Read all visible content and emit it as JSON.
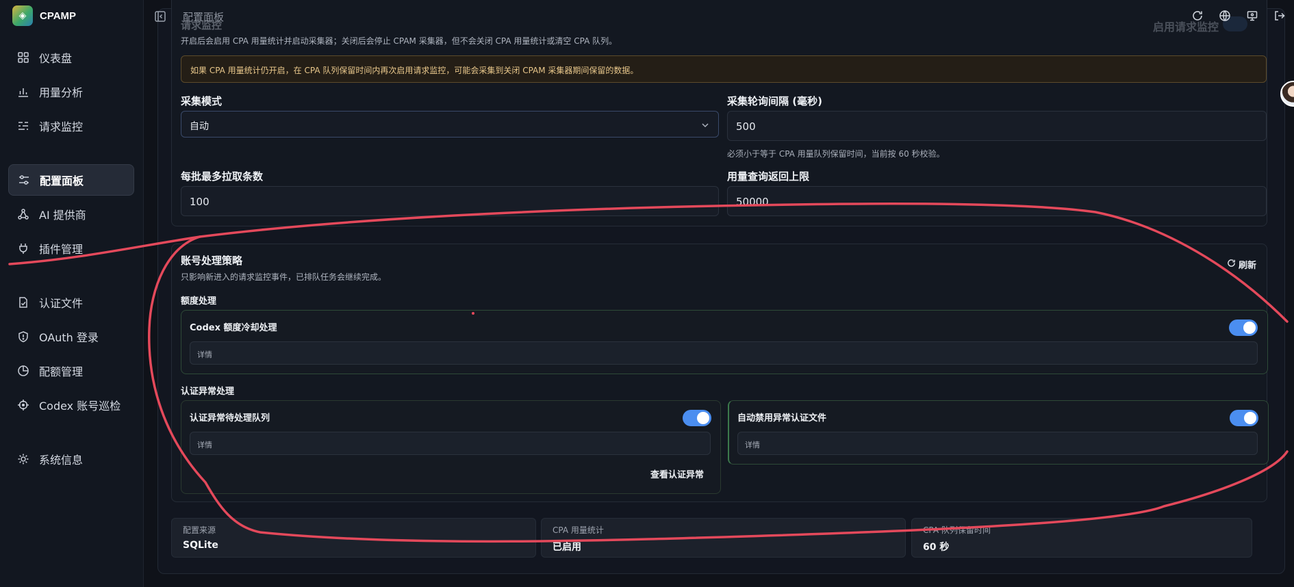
{
  "brand": {
    "name": "CPAMP"
  },
  "topbar": {
    "breadcrumb": "配置面板",
    "faded_label": "启用请求监控"
  },
  "sidebar": {
    "items": [
      {
        "label": "仪表盘",
        "icon": "dashboard-icon"
      },
      {
        "label": "用量分析",
        "icon": "bar-chart-icon"
      },
      {
        "label": "请求监控",
        "icon": "activity-icon"
      },
      {
        "label": "配置面板",
        "icon": "sliders-icon"
      },
      {
        "label": "AI 提供商",
        "icon": "network-icon"
      },
      {
        "label": "插件管理",
        "icon": "plug-icon"
      },
      {
        "label": "认证文件",
        "icon": "file-check-icon"
      },
      {
        "label": "OAuth 登录",
        "icon": "shield-icon"
      },
      {
        "label": "配额管理",
        "icon": "pie-icon"
      },
      {
        "label": "Codex 账号巡检",
        "icon": "crosshair-icon"
      },
      {
        "label": "系统信息",
        "icon": "cpu-icon"
      }
    ],
    "active": "配置面板"
  },
  "monitor": {
    "cut_title": "请求监控",
    "description": "开启后会启用 CPA 用量统计并启动采集器；关闭后会停止 CPAM 采集器，但不会关闭 CPA 用量统计或清空 CPA 队列。",
    "warning": "如果 CPA 用量统计仍开启，在 CPA 队列保留时间内再次启用请求监控，可能会采集到关闭 CPAM 采集器期间保留的数据。",
    "mode_label": "采集模式",
    "mode_value": "自动",
    "interval_label": "采集轮询间隔 (毫秒)",
    "interval_value": "500",
    "interval_hint": "必须小于等于 CPA 用量队列保留时间，当前按 60 秒校验。",
    "batch_label": "每批最多拉取条数",
    "batch_value": "100",
    "limit_label": "用量查询返回上限",
    "limit_value": "50000"
  },
  "policy": {
    "title": "账号处理策略",
    "description": "只影响新进入的请求监控事件，已排队任务会继续完成。",
    "refresh_label": "刷新",
    "quota_section": "额度处理",
    "quota_card_title": "Codex 额度冷却处理",
    "quota_card_detail": "详情",
    "quota_card_on": true,
    "auth_section": "认证异常处理",
    "auth_queue_title": "认证异常待处理队列",
    "auth_queue_detail": "详情",
    "auth_queue_on": true,
    "auth_queue_link": "查看认证异常",
    "auto_disable_title": "自动禁用异常认证文件",
    "auto_disable_detail": "详情",
    "auto_disable_on": true
  },
  "stats": [
    {
      "key": "配置来源",
      "value": "SQLite"
    },
    {
      "key": "CPA 用量统计",
      "value": "已启用"
    },
    {
      "key": "CPA 队列保留时间",
      "value": "60 秒"
    }
  ],
  "colors": {
    "accent": "#4b8ef0",
    "annotation": "#e4495b",
    "warning_text": "#e8c78b"
  }
}
